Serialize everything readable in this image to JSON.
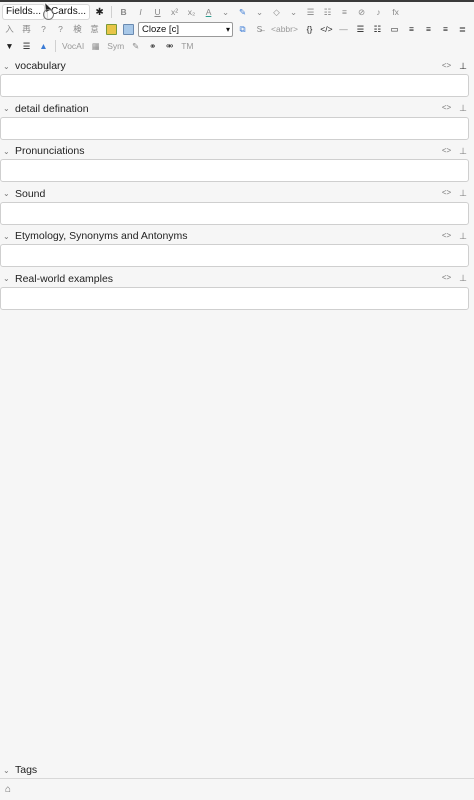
{
  "toolbar": {
    "fields_label": "Fields...",
    "cards_label": "Cards...",
    "row1_icons": [
      "bold-icon",
      "italic-icon",
      "underline-icon",
      "superscript-icon",
      "subscript-icon",
      "text-color-icon",
      "highlight-icon",
      "eraser-icon",
      "bullet-list-icon",
      "numbered-list-icon",
      "indent-icon",
      "attach-icon",
      "mic-icon",
      "formula-icon"
    ],
    "row1_glyphs": {
      "bold": "B",
      "italic": "I",
      "underline": "U",
      "sup": "x²",
      "sub": "x₂",
      "color": "A",
      "fx": "fx"
    },
    "row2": {
      "glyphs": [
        "入",
        "再",
        "?",
        "?",
        "検",
        "意"
      ],
      "cloze_value": "Cloze [c]",
      "abbr": "<abbr>",
      "braces": "{}",
      "code": "</>"
    },
    "row3": {
      "vocai": "VocAI",
      "sym": "Sym",
      "tm": "TM"
    },
    "accent_color": "#2a9d8f",
    "highlight_color": "#3a7bd5"
  },
  "fields": [
    {
      "label": "vocabulary",
      "pinned": true
    },
    {
      "label": "detail defination",
      "pinned": false
    },
    {
      "label": "Pronunciations",
      "pinned": false
    },
    {
      "label": "Sound",
      "pinned": false
    },
    {
      "label": "Etymology, Synonyms and Antonyms",
      "pinned": false
    },
    {
      "label": "Real-world examples",
      "pinned": false
    }
  ],
  "field_html_toggle": "<>",
  "tags": {
    "label": "Tags"
  }
}
